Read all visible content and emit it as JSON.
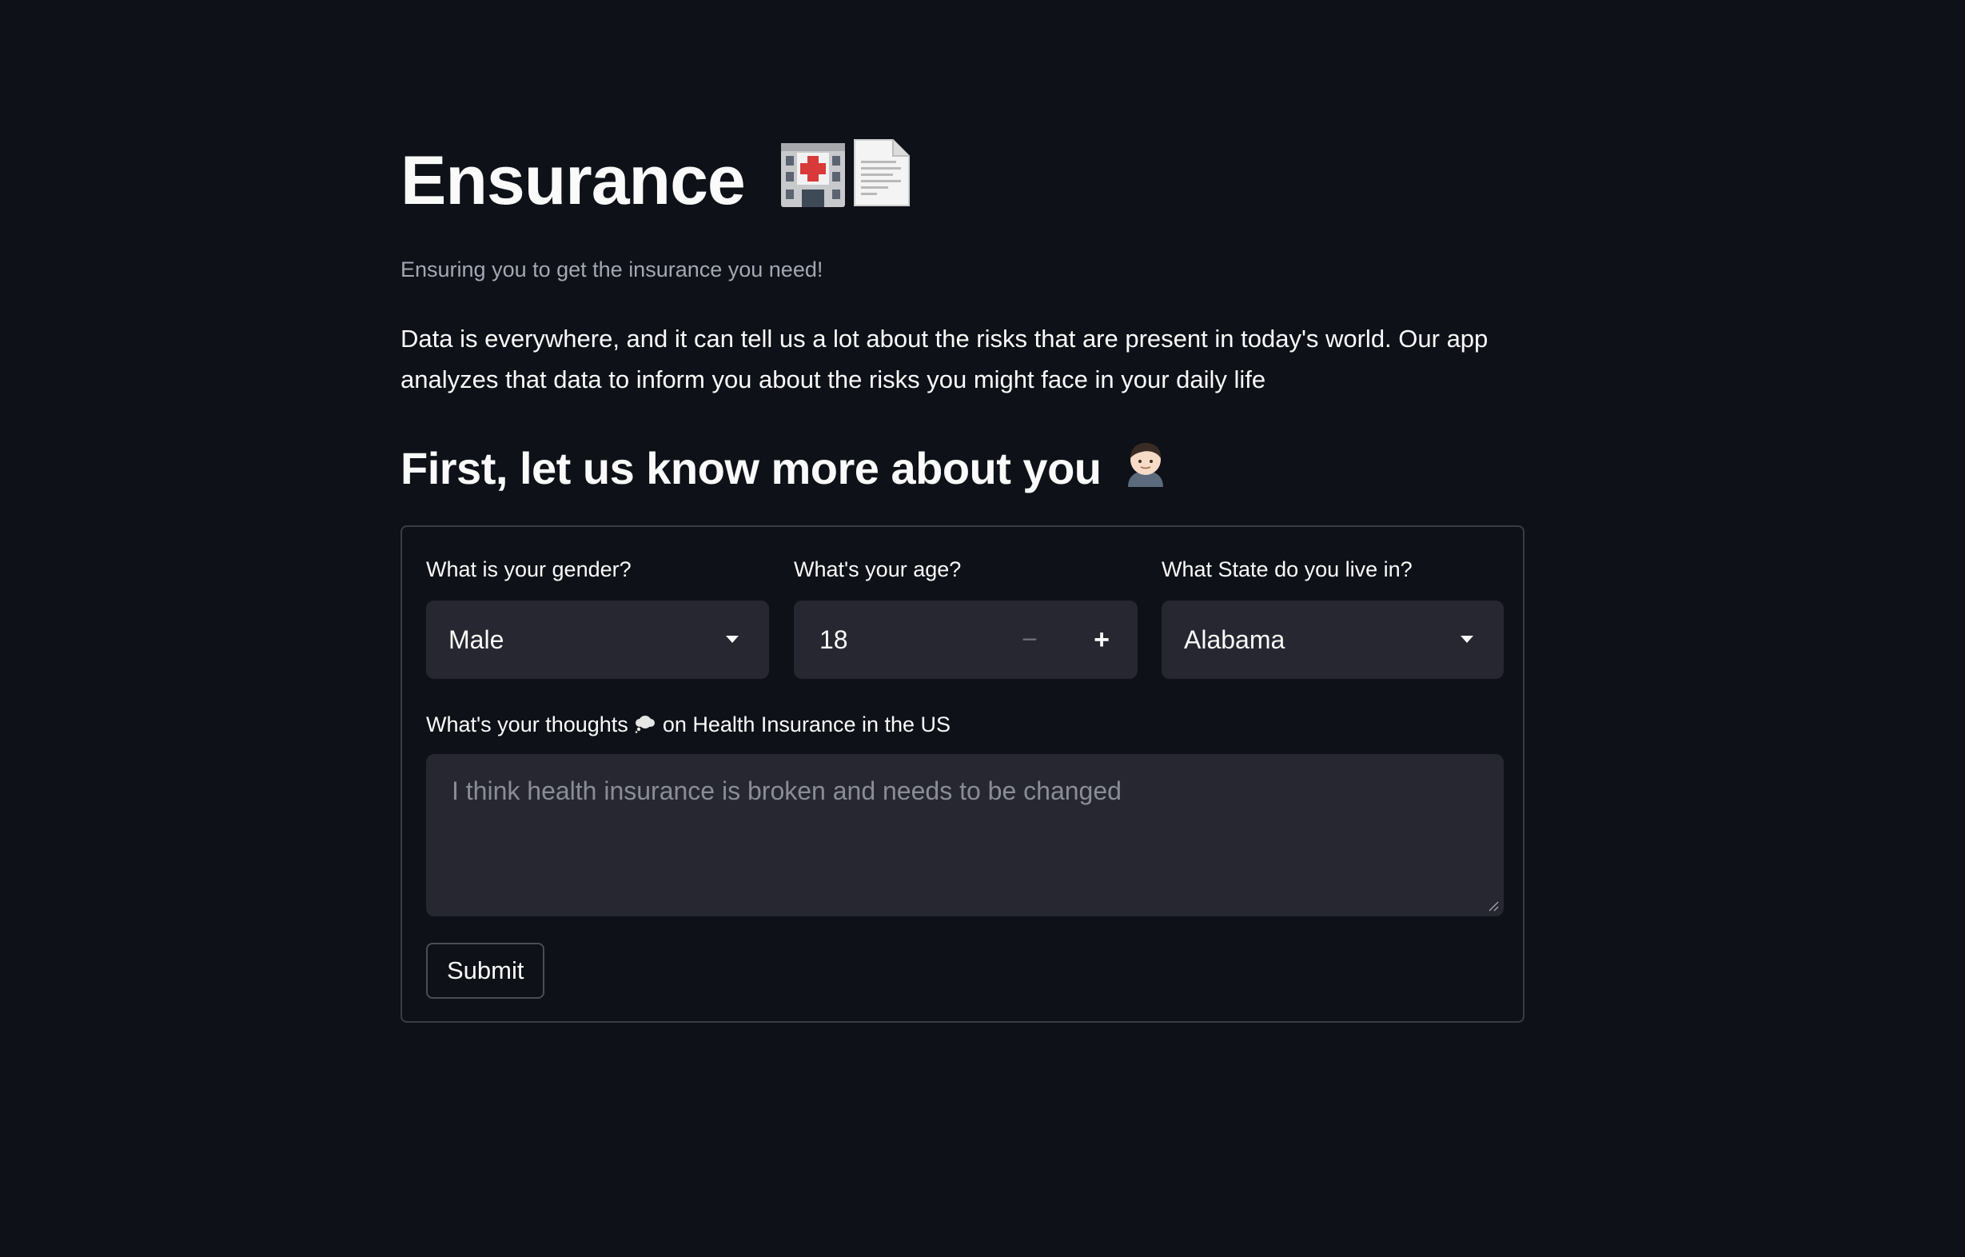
{
  "header": {
    "title": "Ensurance",
    "title_icons": [
      "hospital-icon",
      "document-icon"
    ],
    "subtitle": "Ensuring you to get the insurance you need!",
    "intro": "Data is everywhere, and it can tell us a lot about the risks that are present in today's world. Our app analyzes that data to inform you about the risks you might face in your daily life"
  },
  "section": {
    "heading": "First, let us know more about you",
    "heading_icon": "person-icon"
  },
  "form": {
    "gender": {
      "label": "What is your gender?",
      "value": "Male"
    },
    "age": {
      "label": "What's your age?",
      "value": "18",
      "minus": "−",
      "plus": "+"
    },
    "state": {
      "label": "What State do you live in?",
      "value": "Alabama"
    },
    "thoughts": {
      "label_before": "What's your thoughts",
      "label_icon": "thought-bubble-icon",
      "label_after": "on Health Insurance in the US",
      "placeholder": "I think health insurance is broken and needs to be changed",
      "value": ""
    },
    "submit_label": "Submit"
  },
  "colors": {
    "background": "#0e1117",
    "input_background": "#262730",
    "text": "#fafafa",
    "muted_text": "#a3a8b4",
    "placeholder": "#8a8d97",
    "border": "#3a3d46"
  }
}
